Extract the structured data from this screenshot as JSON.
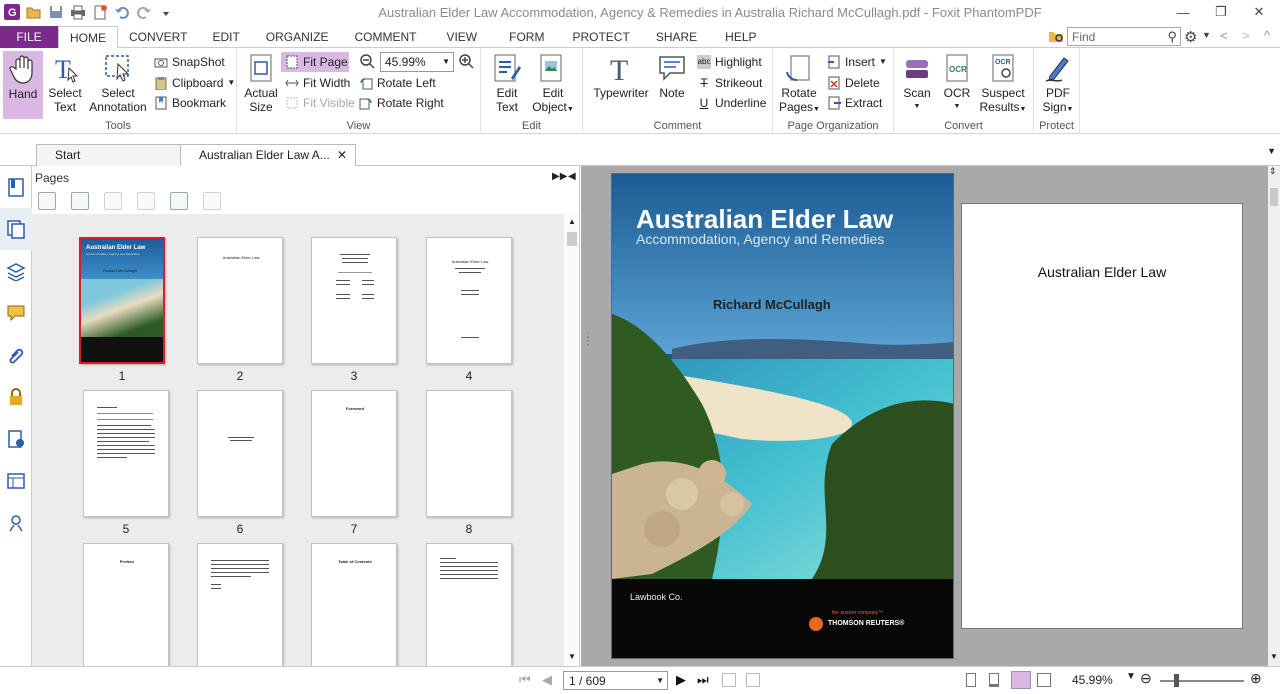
{
  "window": {
    "title": "Australian Elder Law Accommodation, Agency & Remedies in Australia Richard McCullagh.pdf - Foxit PhantomPDF"
  },
  "menu": {
    "tabs": [
      "FILE",
      "HOME",
      "CONVERT",
      "EDIT",
      "ORGANIZE",
      "COMMENT",
      "VIEW",
      "FORM",
      "PROTECT",
      "SHARE",
      "HELP"
    ],
    "find_placeholder": "Find"
  },
  "ribbon": {
    "tools": {
      "label": "Tools",
      "hand": "Hand",
      "select_text_1": "Select",
      "select_text_2": "Text",
      "select_annot_1": "Select",
      "select_annot_2": "Annotation",
      "snapshot": "SnapShot",
      "clipboard": "Clipboard",
      "bookmark": "Bookmark"
    },
    "view": {
      "label": "View",
      "actual_1": "Actual",
      "actual_2": "Size",
      "fit_page": "Fit Page",
      "fit_width": "Fit Width",
      "fit_visible": "Fit Visible",
      "zoom": "45.99%",
      "rotate_left": "Rotate Left",
      "rotate_right": "Rotate Right"
    },
    "edit": {
      "label": "Edit",
      "edit_text_1": "Edit",
      "edit_text_2": "Text",
      "edit_obj_1": "Edit",
      "edit_obj_2": "Object"
    },
    "comment": {
      "label": "Comment",
      "typewriter": "Typewriter",
      "note": "Note",
      "highlight": "Highlight",
      "strikeout": "Strikeout",
      "underline": "Underline"
    },
    "org": {
      "label": "Page Organization",
      "rotate_1": "Rotate",
      "rotate_2": "Pages",
      "insert": "Insert",
      "delete": "Delete",
      "extract": "Extract"
    },
    "convert": {
      "label": "Convert",
      "scan": "Scan",
      "ocr": "OCR",
      "suspect_1": "Suspect",
      "suspect_2": "Results"
    },
    "protect": {
      "label": "Protect",
      "sign_1": "PDF",
      "sign_2": "Sign"
    }
  },
  "doc_tabs": {
    "start": "Start",
    "current": "Australian Elder Law A..."
  },
  "pages_panel": {
    "title": "Pages",
    "numbers": [
      "1",
      "2",
      "3",
      "4",
      "5",
      "6",
      "7",
      "8"
    ]
  },
  "thumb_text": {
    "p1_title": "Australian Elder Law",
    "p1_sub": "Accommodation, Agency and Remedies",
    "p1_author": "Richard McCullagh",
    "p2": "Australian Elder Law",
    "p4": "Australian Elder Law",
    "p7": "Foreword",
    "p9": "Preface",
    "p11": "Table of Contents"
  },
  "cover": {
    "title": "Australian Elder Law",
    "subtitle": "Accommodation, Agency and Remedies",
    "author": "Richard McCullagh",
    "publisher": "Lawbook Co.",
    "tagline": "the answer company™",
    "brand": "THOMSON REUTERS®"
  },
  "page2": {
    "title": "Australian Elder Law"
  },
  "status": {
    "page": "1 / 609",
    "zoom": "45.99%"
  },
  "colors": {
    "file_tab": "#7b2a8b",
    "selected_thumb": "#d4202a",
    "hand_bg": "#d9b9e3"
  }
}
